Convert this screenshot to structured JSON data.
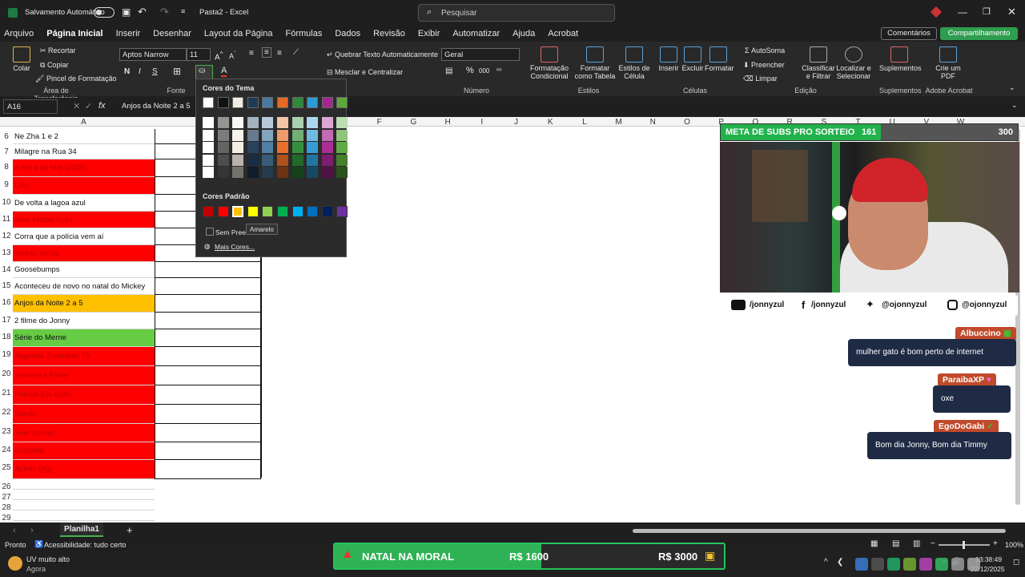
{
  "titlebar": {
    "autosave_label": "Salvamento Automático",
    "file_title": "Pasta2 - Excel",
    "search_placeholder": "Pesquisar"
  },
  "menu": [
    "Arquivo",
    "Página Inicial",
    "Inserir",
    "Desenhar",
    "Layout da Página",
    "Fórmulas",
    "Dados",
    "Revisão",
    "Exibir",
    "Automatizar",
    "Ajuda",
    "Acrobat"
  ],
  "menu_right": {
    "comments": "Comentários",
    "share": "Compartilhamento"
  },
  "ribbon": {
    "paste": "Colar",
    "cut": "Recortar",
    "copy": "Copiar",
    "format_painter": "Pincel de Formatação",
    "clipboard_group": "Área de Transferência",
    "font_name": "Aptos Narrow",
    "font_size": "11",
    "font_group": "Fonte",
    "bold": "N",
    "italic": "I",
    "underline": "S",
    "wrap_text": "Quebrar Texto Automaticamente",
    "merge_center": "Mesclar e Centralizar",
    "number_format": "Geral",
    "number_group": "Número",
    "conditional_format": "Formatação Condicional",
    "format_table": "Formatar como Tabela",
    "cell_styles": "Estilos de Célula",
    "styles_group": "Estilos",
    "insert": "Inserir",
    "delete": "Excluir",
    "format": "Formatar",
    "cells_group": "Células",
    "autosum": "AutoSoma",
    "fill": "Preencher",
    "clear": "Limpar",
    "sort_filter": "Classificar e Filtrar",
    "find_select": "Localizar e Selecionar",
    "editing_group": "Edição",
    "addins": "Suplementos",
    "addins_group": "Suplementos",
    "create_pdf": "Crie um PDF",
    "acrobat_group": "Adobe Acrobat"
  },
  "formula_bar": {
    "name_box": "A16",
    "fx": "fx",
    "content": "Anjos da Noite 2 a 5"
  },
  "columns": [
    "A",
    "E",
    "F",
    "G",
    "H",
    "I",
    "J",
    "K",
    "L",
    "M",
    "N",
    "O",
    "P",
    "Q",
    "R",
    "S",
    "T",
    "U",
    "V",
    "W"
  ],
  "rows": [
    {
      "num": "6",
      "text": "Ne Zha 1 e 2",
      "fill": "#ffffff",
      "color": "#111111"
    },
    {
      "num": "7",
      "text": "Milagre na Rua 34",
      "fill": "#ffffff",
      "color": "#111111"
    },
    {
      "num": "8",
      "text": "A Hora do Mal (2025)",
      "fill": "#ff0000",
      "color": "#c00000"
    },
    {
      "num": "9",
      "text": "Lolo",
      "fill": "#ff0000",
      "color": "#c00000"
    },
    {
      "num": "10",
      "text": "De volta a lagoa azul",
      "fill": "#ffffff",
      "color": "#111111"
    },
    {
      "num": "11",
      "text": "Mais Mortal Ação",
      "fill": "#ff0000",
      "color": "#c00000"
    },
    {
      "num": "12",
      "text": "Corra que a polícia vem aí",
      "fill": "#ffffff",
      "color": "#111111"
    },
    {
      "num": "13",
      "text": "Melhor Ainda",
      "fill": "#ff0000",
      "color": "#c00000"
    },
    {
      "num": "14",
      "text": "Goosebumps",
      "fill": "#ffffff",
      "color": "#111111"
    },
    {
      "num": "15",
      "text": "Aconteceu de novo no natal do Mickey",
      "fill": "#ffffff",
      "color": "#111111"
    },
    {
      "num": "16",
      "text": "Anjos da Noite 2 a 5",
      "fill": "#ffc000",
      "color": "#111111"
    },
    {
      "num": "17",
      "text": "2 filme do Jonny",
      "fill": "#ffffff",
      "color": "#111111"
    },
    {
      "num": "18",
      "text": "Série do Merne",
      "fill": "#66cc44",
      "color": "#111111"
    },
    {
      "num": "19",
      "text": "Angelina Zumbikas TV",
      "fill": "#ff0000",
      "color": "#c00000"
    },
    {
      "num": "20",
      "text": "Homem e Filme",
      "fill": "#ff0000",
      "color": "#c00000"
    },
    {
      "num": "21",
      "text": "Policial Em Ação",
      "fill": "#ff0000",
      "color": "#c00000"
    },
    {
      "num": "22",
      "text": "Bando",
      "fill": "#ff0000",
      "color": "#c00000"
    },
    {
      "num": "23",
      "text": "Sem querer",
      "fill": "#ff0000",
      "color": "#c00000"
    },
    {
      "num": "24",
      "text": "Escondo",
      "fill": "#ff0000",
      "color": "#c00000"
    },
    {
      "num": "25",
      "text": "Acerto Digi",
      "fill": "#ff0000",
      "color": "#c00000"
    },
    {
      "num": "26",
      "text": "",
      "fill": "#ffffff",
      "color": "#111111"
    },
    {
      "num": "27",
      "text": "",
      "fill": "#ffffff",
      "color": "#111111"
    },
    {
      "num": "28",
      "text": "",
      "fill": "#ffffff",
      "color": "#111111"
    },
    {
      "num": "29",
      "text": "",
      "fill": "#ffffff",
      "color": "#111111"
    }
  ],
  "color_picker": {
    "theme_title": "Cores do Tema",
    "standard_title": "Cores Padrão",
    "no_fill": "Sem Preenchimento",
    "more_colors": "Mais Cores...",
    "tooltip": "Amarelo",
    "theme_top": [
      "#ffffff",
      "#111111",
      "#f2ede3",
      "#1f3b57",
      "#4a7aa0",
      "#e66a26",
      "#2e8a36",
      "#2c9bd4",
      "#a62592",
      "#5aa83c"
    ],
    "standard": [
      "#c00000",
      "#ff0000",
      "#ffc000",
      "#ffff00",
      "#92d050",
      "#00b050",
      "#00b0f0",
      "#0070c0",
      "#002060",
      "#7030a0"
    ]
  },
  "sheets": {
    "active": "Planilha1"
  },
  "status": {
    "ready": "Pronto",
    "accessibility": "Acessibilidade: tudo certo",
    "zoom": "100%"
  },
  "overlay": {
    "goal_title": "META DE SUBS PRO SORTEIO",
    "goal_current": "161",
    "goal_target": "300",
    "goal_fraction": 0.54,
    "socials": [
      "/jonnyzul",
      "/jonnyzul",
      "@ojonnyzul",
      "@ojonnyzul"
    ],
    "chat": [
      {
        "user": "Albuccino",
        "msg": "mulher gato é bom perto de internet"
      },
      {
        "user": "ParaibaXP",
        "msg": "oxe"
      },
      {
        "user": "EgoDoGabi",
        "msg": "Bom dia Jonny, Bom dia Timmy"
      }
    ],
    "natal_title": "NATAL NA MORAL",
    "natal_current": "R$ 1600",
    "natal_target": "R$ 3000",
    "natal_fraction": 0.53
  },
  "taskbar": {
    "weather_title": "UV muito alto",
    "weather_sub": "Agora",
    "time": "13:38:49",
    "date": "22/12/2025"
  }
}
